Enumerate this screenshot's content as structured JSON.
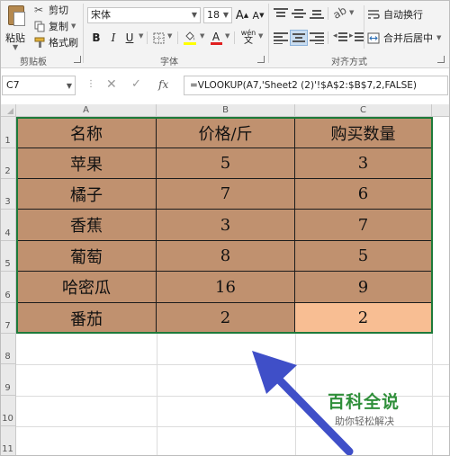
{
  "ribbon": {
    "clipboard": {
      "paste_label": "粘贴",
      "cut_label": "剪切",
      "copy_label": "复制",
      "format_painter_label": "格式刷",
      "group_label": "剪贴板"
    },
    "font": {
      "font_name": "宋体",
      "font_size": "18",
      "grow_label": "A",
      "shrink_label": "A",
      "bold": "B",
      "italic": "I",
      "underline": "U",
      "font_color_label": "A",
      "phonetic_label": "wén",
      "group_label": "字体"
    },
    "alignment": {
      "wrap_text_label": "自动换行",
      "merge_center_label": "合并后居中",
      "group_label": "对齐方式"
    }
  },
  "formula_bar": {
    "name_box": "C7",
    "formula": "=VLOOKUP(A7,'Sheet2 (2)'!$A$2:$B$7,2,FALSE)",
    "fx_label": "fx"
  },
  "sheet": {
    "columns": [
      "A",
      "B",
      "C"
    ],
    "rows": [
      "1",
      "2",
      "3",
      "4",
      "5",
      "6",
      "7",
      "8",
      "9",
      "10",
      "11"
    ],
    "headers": [
      "名称",
      "价格/斤",
      "购买数量"
    ],
    "data": [
      [
        "苹果",
        "5",
        "3"
      ],
      [
        "橘子",
        "7",
        "6"
      ],
      [
        "香蕉",
        "3",
        "7"
      ],
      [
        "葡萄",
        "8",
        "5"
      ],
      [
        "哈密瓜",
        "16",
        "9"
      ],
      [
        "番茄",
        "2",
        "2"
      ]
    ],
    "selected_cell": "C7"
  },
  "colors": {
    "cell_fill": "#c0916f",
    "selected_fill": "#f8be93",
    "selection_outline": "#1e7a3a",
    "arrow": "#3f4fc8",
    "watermark": "#2f8f3a"
  },
  "watermark": {
    "title": "百科全说",
    "subtitle": "助你轻松解决"
  }
}
